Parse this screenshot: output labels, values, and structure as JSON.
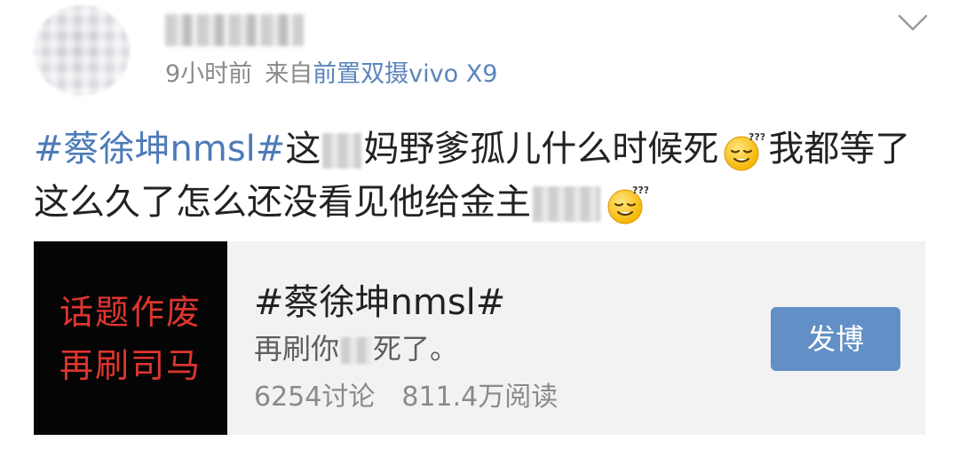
{
  "post": {
    "username": "",
    "time": "9小时前",
    "source_prefix": "来自",
    "device": "前置双摄vivo X9",
    "content": {
      "hashtag": "#蔡徐坤nmsl#",
      "line1_part1": "这",
      "line1_part2": "妈野爹孤儿什么时候死",
      "line1_part3": "我都等了",
      "line2": "这么久了怎么还没看见他给金主",
      "emoji": "sleepy-emoji"
    },
    "card": {
      "thumb_line1": "话题作废",
      "thumb_line2": "再刷司马",
      "title": "#蔡徐坤nmsl#",
      "desc_part1": "再刷你",
      "desc_part2": "死了。",
      "discussions": "6254讨论",
      "views": "811.4万阅读",
      "button_label": "发博"
    }
  },
  "colors": {
    "link_blue": "#4c7bb8",
    "button_blue": "#628fc6",
    "thumb_red": "#e0352f",
    "meta_gray": "#8a8a8a"
  }
}
